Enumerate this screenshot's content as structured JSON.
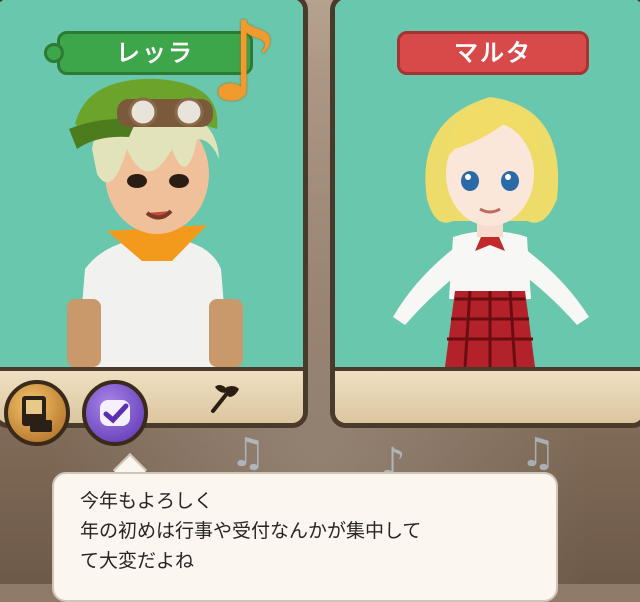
{
  "left_panel": {
    "name": "レッラ",
    "name_color": "#3da54a",
    "icons": [
      "music-note-icon",
      "axe-icon"
    ]
  },
  "right_panel": {
    "name": "マルタ",
    "name_color": "#d84a4a"
  },
  "action_buttons": [
    {
      "icon": "map-book-icon",
      "color": "#e2a548"
    },
    {
      "icon": "check-badge-icon",
      "color": "#7b52d0"
    }
  ],
  "dialog": {
    "lines": [
      "今年もよろしく",
      "年の初めは行事や受付なんかが集中して",
      "て大変だよね"
    ]
  }
}
